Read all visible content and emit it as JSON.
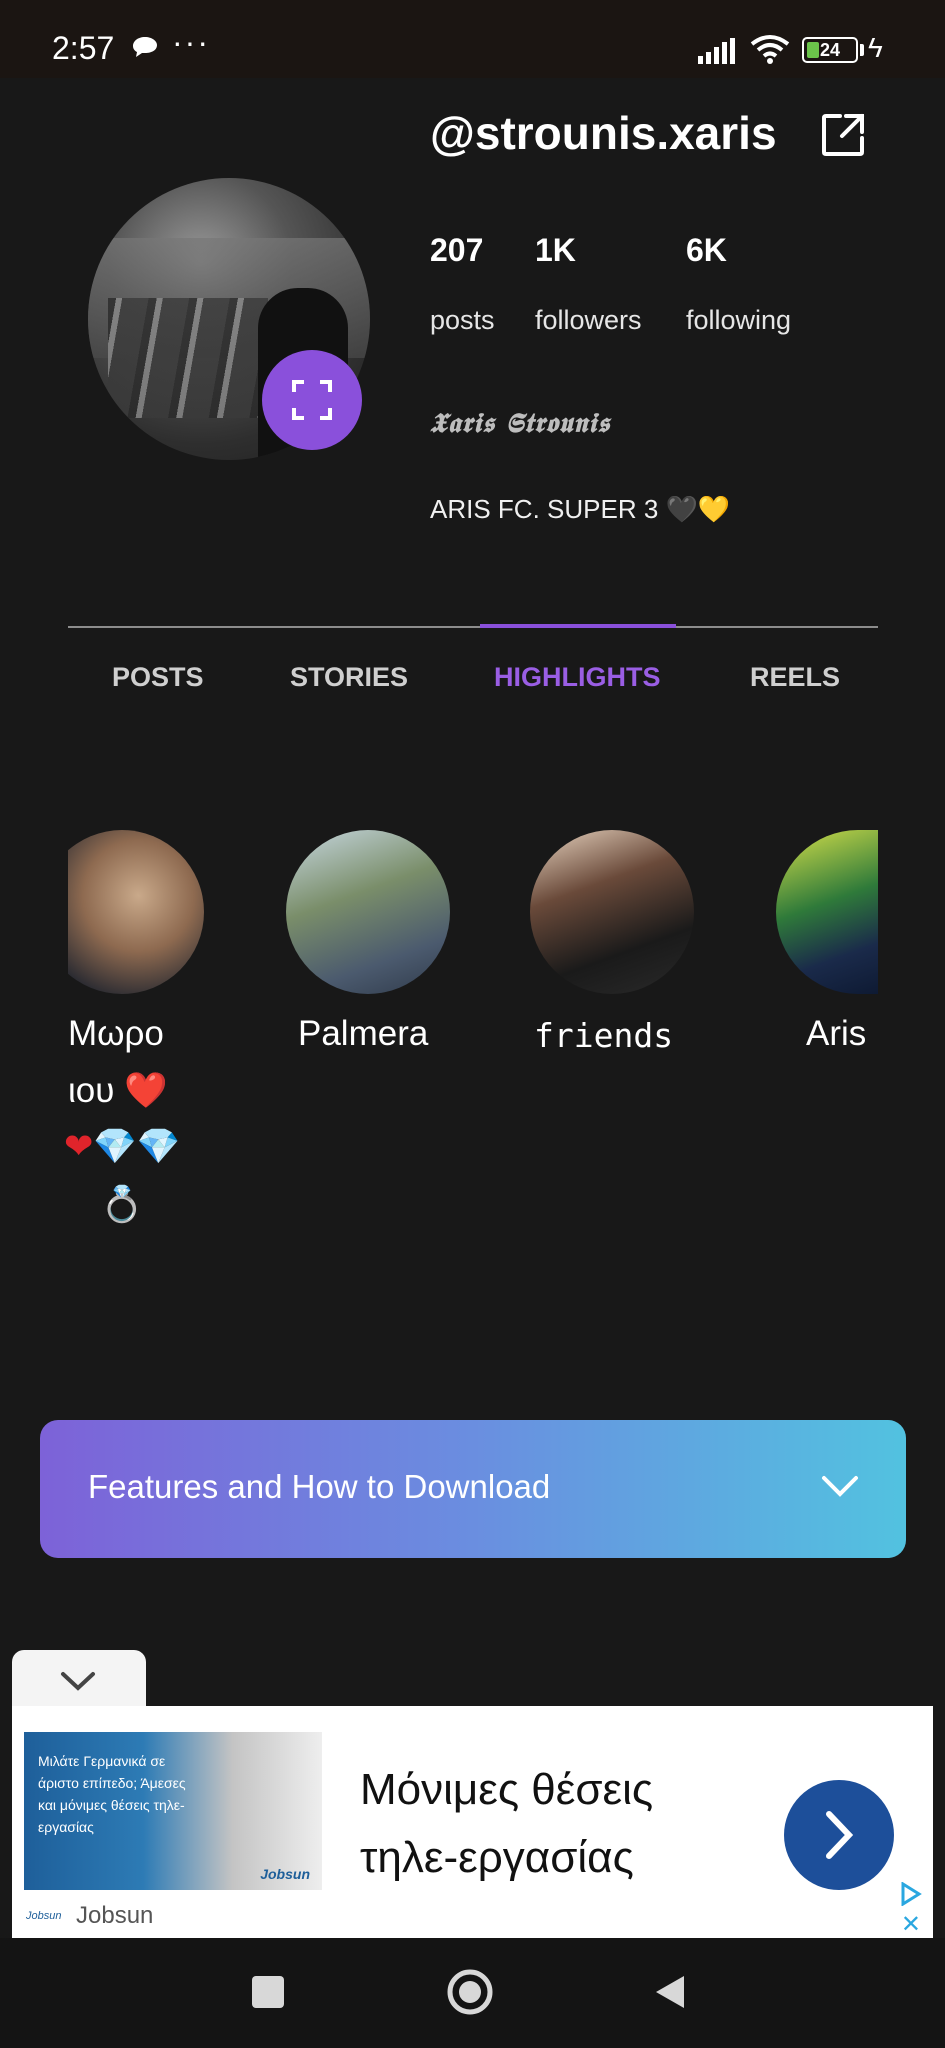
{
  "status_bar": {
    "time": "2:57",
    "more": "···",
    "battery": "24"
  },
  "profile": {
    "handle": "@strounis.xaris",
    "stats": [
      {
        "value": "207",
        "label": "posts"
      },
      {
        "value": "1K",
        "label": "followers"
      },
      {
        "value": "6K",
        "label": "following"
      }
    ],
    "full_name": "𝖃𝖆𝖗𝖎𝖘 𝕾𝖙𝖗𝖔𝖚𝖓𝖎𝖘",
    "bio": "ARIS FC. SUPER 3",
    "bio_emoji_1": "🖤",
    "bio_emoji_2": "💛"
  },
  "tabs": {
    "items": [
      "POSTS",
      "STORIES",
      "HIGHLIGHTS",
      "REELS"
    ],
    "active": "HIGHLIGHTS"
  },
  "highlights": [
    {
      "label_line1": "Μωρο",
      "label_line2": "μου",
      "label_emoji_line2": "❤️",
      "label_emoji_line3_a": "❤",
      "label_emoji_line3_b": "💎💎",
      "label_emoji_line4": "💍"
    },
    {
      "label_line1": "Palmera"
    },
    {
      "label_line1": "friends"
    },
    {
      "label_line1": "Aris"
    }
  ],
  "highlight_partial_text": "ιου",
  "features": {
    "title": "Features and How to Download"
  },
  "ad": {
    "image_text": "Μιλάτε Γερμανικά σε άριστο επίπεδο; Άμεσες και μόνιμες θέσεις τηλε-εργασίας",
    "image_logo": "Jobsun",
    "headline": "Μόνιμες θέσεις τηλε-εργασίας",
    "brand": "Jobsun",
    "brand_logo": "Jobsun",
    "close": "✕"
  },
  "colors": {
    "background": "#181818",
    "accent": "#8a50db",
    "ad_button": "#1d4f9a"
  }
}
